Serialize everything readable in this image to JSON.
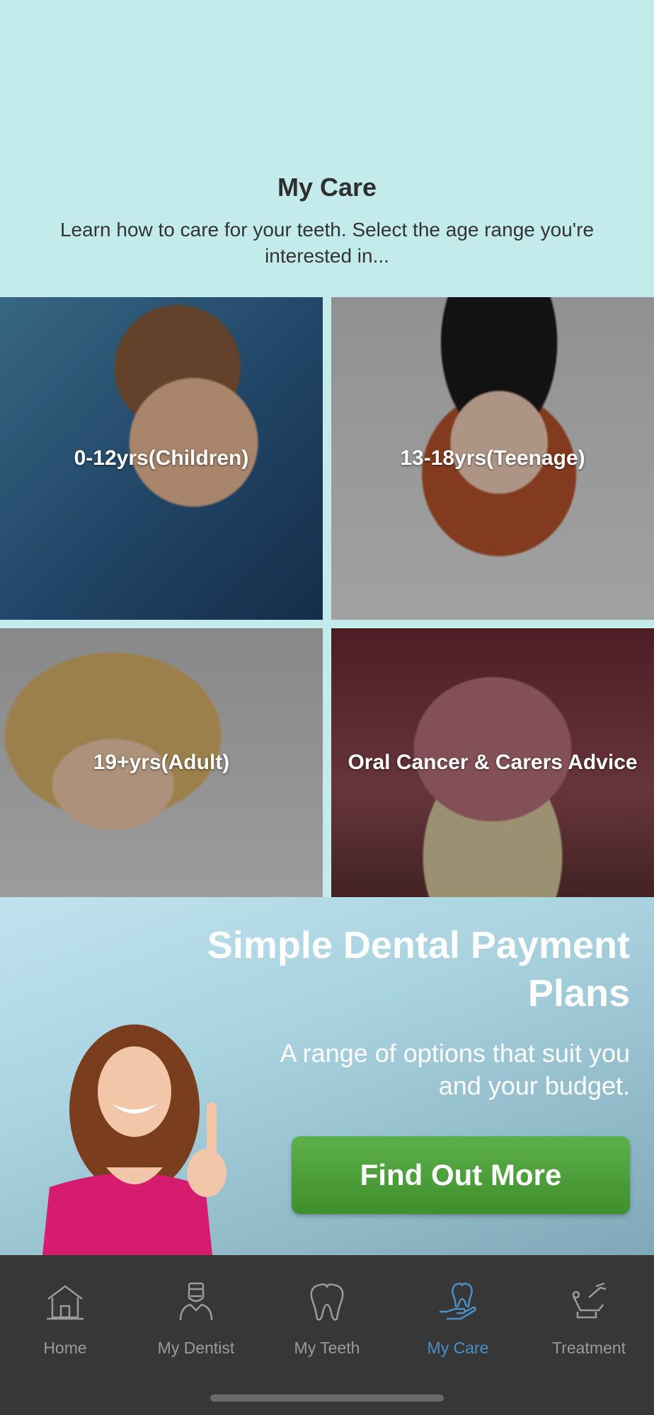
{
  "header": {
    "title": "My Care",
    "subtitle": "Learn how to care for your teeth. Select the age range you're interested in..."
  },
  "tiles": [
    {
      "label": "0-12yrs(Children)"
    },
    {
      "label": "13-18yrs(Teenage)"
    },
    {
      "label": "19+yrs(Adult)"
    },
    {
      "label": "Oral Cancer & Carers Advice"
    }
  ],
  "promo": {
    "title": "Simple Dental Payment Plans",
    "text": "A range of options that suit you and your budget.",
    "button_label": "Find Out More"
  },
  "tabbar": {
    "active": "My Care",
    "items": [
      {
        "label": "Home",
        "icon": "home-icon"
      },
      {
        "label": "My Dentist",
        "icon": "dentist-icon"
      },
      {
        "label": "My Teeth",
        "icon": "tooth-icon"
      },
      {
        "label": "My Care",
        "icon": "care-hand-tooth-icon"
      },
      {
        "label": "Treatment",
        "icon": "dental-chair-icon"
      }
    ]
  },
  "colors": {
    "header_bg": "#c3ebec",
    "tabbar_bg": "#373737",
    "tab_active": "#4a90c9",
    "tab_inactive": "#9b9b9b",
    "button_green": "#4ea23b"
  }
}
